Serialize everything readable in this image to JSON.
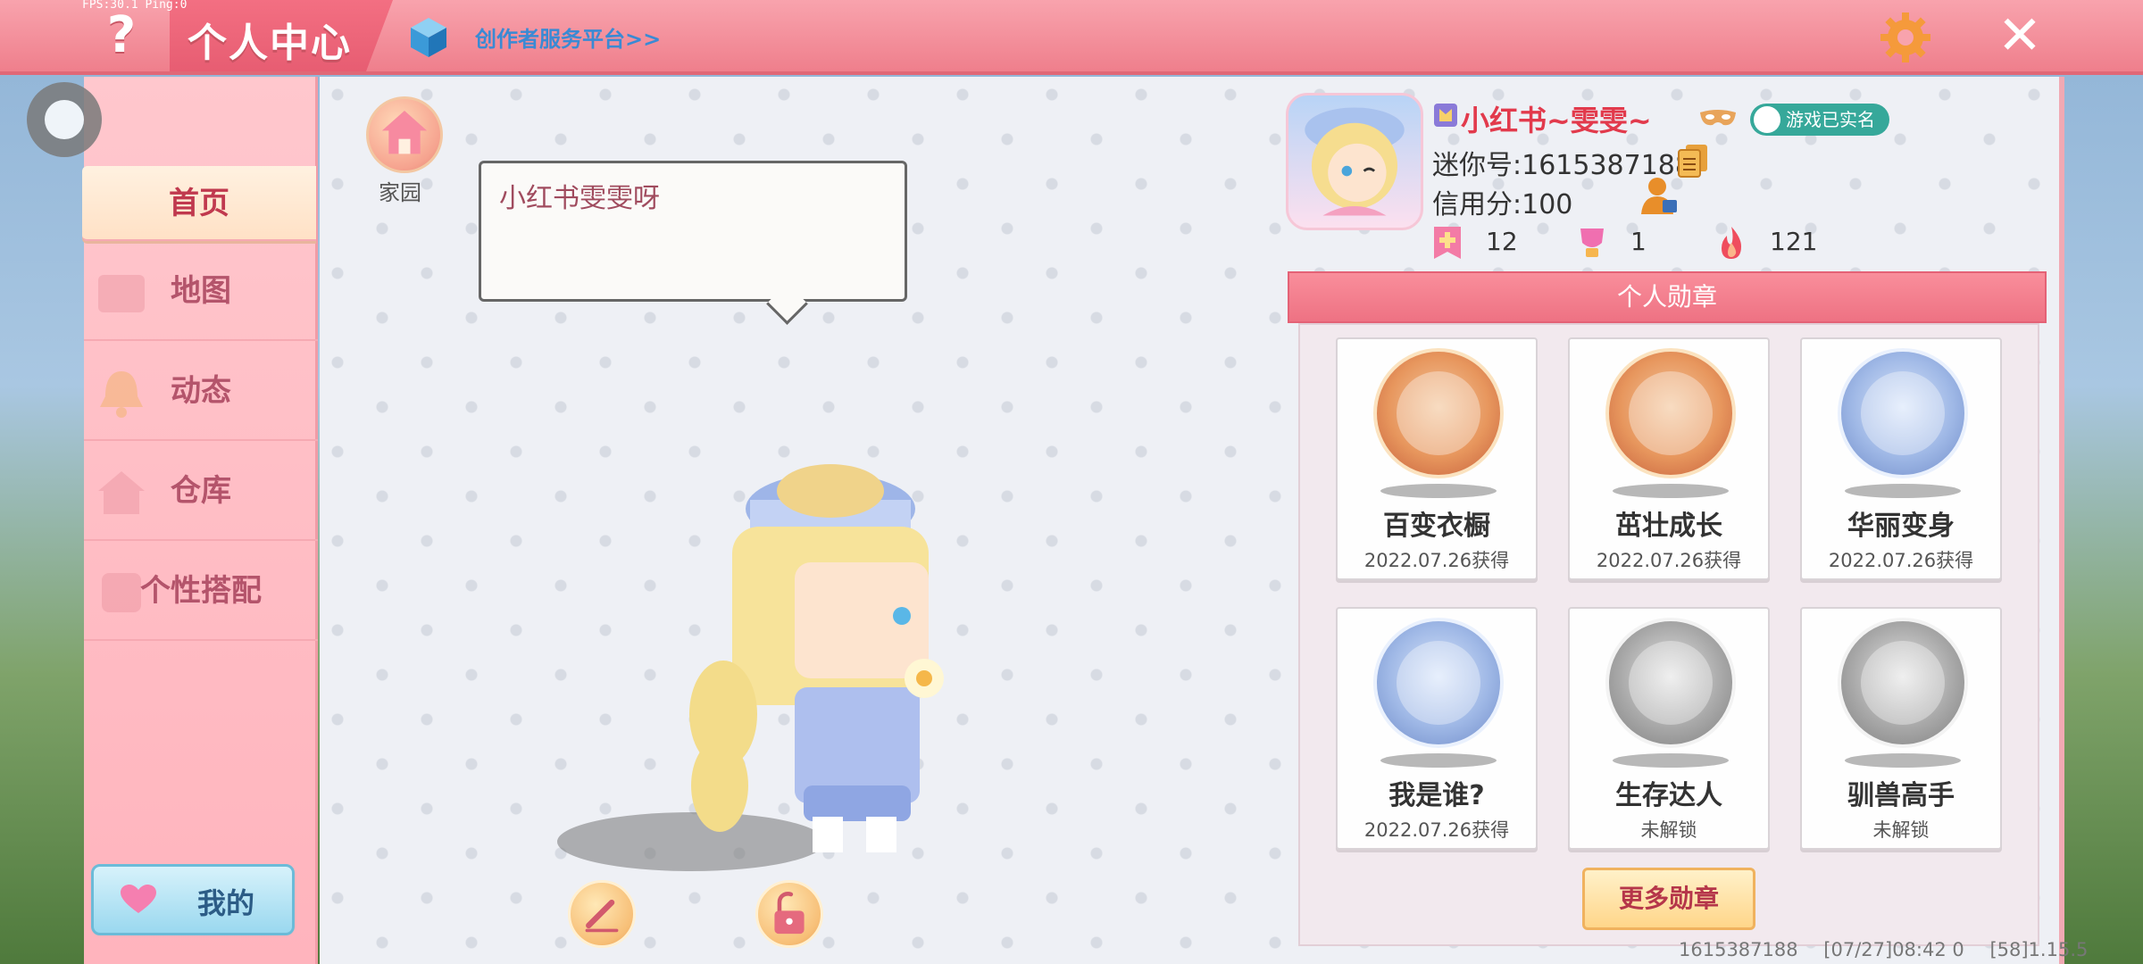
{
  "debug": {
    "fps": "FPS:30.1  Ping:0"
  },
  "header": {
    "help_label": "?",
    "title": "个人中心",
    "creator_link": "创作者服务平台>>",
    "close_label": "✕"
  },
  "sidebar": {
    "items": [
      {
        "label": "首页"
      },
      {
        "label": "地图"
      },
      {
        "label": "动态"
      },
      {
        "label": "仓库"
      },
      {
        "label": "个性搭配"
      }
    ],
    "me_label": "我的"
  },
  "home": {
    "label": "家园"
  },
  "speech": {
    "text": "小红书雯雯呀"
  },
  "profile": {
    "username": "小红书~雯雯~",
    "realname_badge": "游戏已实名",
    "mini_id": "迷你号:1615387188",
    "credit": "信用分:100",
    "stats": [
      {
        "icon": "medal-plus-icon",
        "value": "12"
      },
      {
        "icon": "trophy-icon",
        "value": "1"
      },
      {
        "icon": "fire-icon",
        "value": "121"
      }
    ]
  },
  "medals": {
    "header": "个人勋章",
    "items": [
      {
        "name": "百变衣橱",
        "date": "2022.07.26获得",
        "style": "gold"
      },
      {
        "name": "茁壮成长",
        "date": "2022.07.26获得",
        "style": "gold"
      },
      {
        "name": "华丽变身",
        "date": "2022.07.26获得",
        "style": "blue"
      },
      {
        "name": "我是谁?",
        "date": "2022.07.26获得",
        "style": "blue"
      },
      {
        "name": "生存达人",
        "date": "未解锁",
        "style": "gray"
      },
      {
        "name": "驯兽高手",
        "date": "未解锁",
        "style": "gray"
      }
    ],
    "more_label": "更多勋章"
  },
  "footer": {
    "uid": "1615387188",
    "time": "[07/27]08:42 0",
    "version": "[58]1.15.5"
  },
  "colors": {
    "accent": "#ef7f8c",
    "title_text": "#c0394e",
    "username": "#e23a4c"
  }
}
